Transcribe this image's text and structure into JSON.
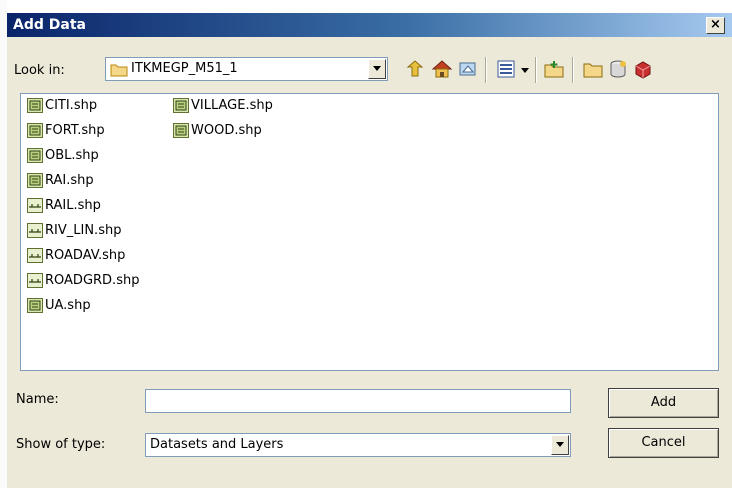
{
  "dialog": {
    "title": "Add Data",
    "close_label": "×",
    "look_in_label": "Look in:",
    "look_in_value": "ITKMEGP_M51_1",
    "name_label": "Name:",
    "name_value": "",
    "type_label": "Show of type:",
    "type_value": "Datasets and Layers",
    "add_label": "Add",
    "cancel_label": "Cancel"
  },
  "files": [
    {
      "name": "CITI.shp",
      "kind": "polygon"
    },
    {
      "name": "FORT.shp",
      "kind": "polygon"
    },
    {
      "name": "OBL.shp",
      "kind": "polygon"
    },
    {
      "name": "RAI.shp",
      "kind": "polygon"
    },
    {
      "name": "RAIL.shp",
      "kind": "line"
    },
    {
      "name": "RIV_LIN.shp",
      "kind": "line"
    },
    {
      "name": "ROADAV.shp",
      "kind": "line"
    },
    {
      "name": "ROADGRD.shp",
      "kind": "line"
    },
    {
      "name": "UA.shp",
      "kind": "polygon"
    },
    {
      "name": "VILLAGE.shp",
      "kind": "polygon"
    },
    {
      "name": "WOOD.shp",
      "kind": "polygon"
    }
  ],
  "toolbar": {
    "icons": [
      "up-one-level-icon",
      "home-icon",
      "catalog-connect-icon",
      "list-view-icon",
      "view-dropdown-icon",
      "connect-folder-icon",
      "new-folder-icon",
      "new-geodatabase-icon",
      "toolbox-icon"
    ]
  },
  "colors": {
    "title_gradient_start": "#0a246a",
    "title_gradient_end": "#a6caf0",
    "dialog_background": "#ece9d8",
    "field_border": "#7f9db9"
  }
}
